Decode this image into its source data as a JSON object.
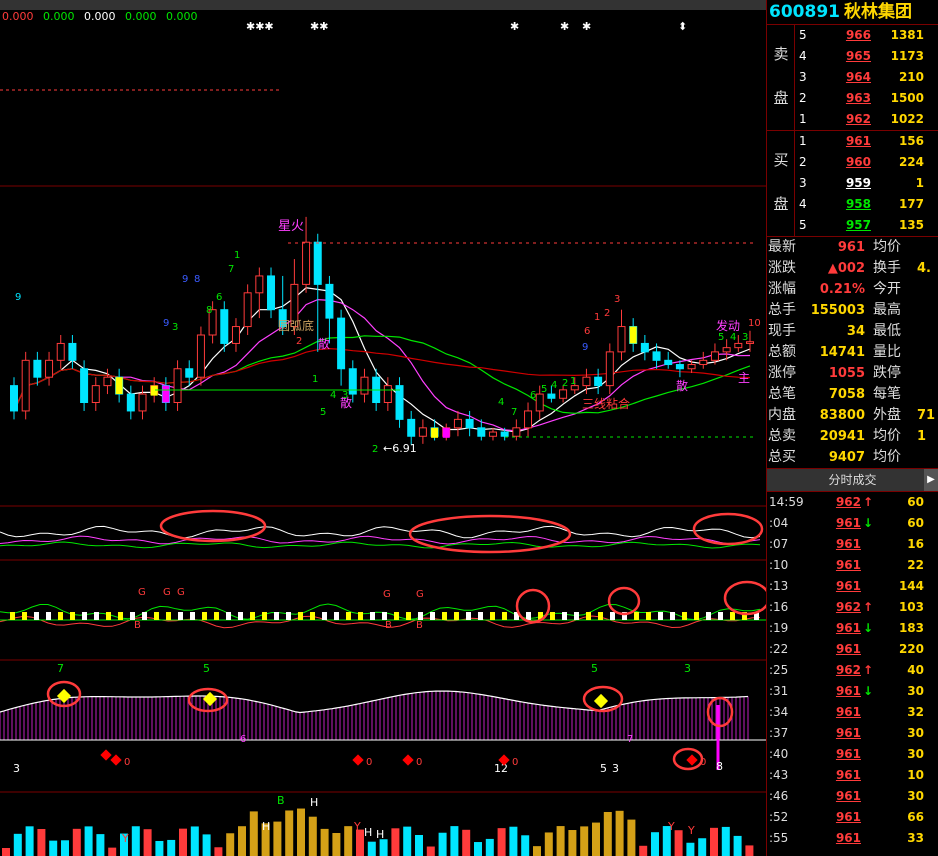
{
  "ma_values": [
    "0.000",
    "0.000",
    "0.000",
    "0.000",
    "0.000"
  ],
  "ma_colors": [
    "#ff3b3b",
    "#00e600",
    "#ffffff",
    "#00e600",
    "#00e600"
  ],
  "stock": {
    "code": "600891",
    "name": "秋林集团"
  },
  "order_book": {
    "sell_label": [
      "卖",
      "盘"
    ],
    "buy_label": [
      "买",
      "盘"
    ],
    "sell": [
      {
        "level": "5",
        "price": "966",
        "vol": "1381",
        "dir": "up"
      },
      {
        "level": "4",
        "price": "965",
        "vol": "1173",
        "dir": "up"
      },
      {
        "level": "3",
        "price": "964",
        "vol": "210",
        "dir": "up"
      },
      {
        "level": "2",
        "price": "963",
        "vol": "1500",
        "dir": "up"
      },
      {
        "level": "1",
        "price": "962",
        "vol": "1022",
        "dir": "up"
      }
    ],
    "buy": [
      {
        "level": "1",
        "price": "961",
        "vol": "156",
        "dir": "up"
      },
      {
        "level": "2",
        "price": "960",
        "vol": "224",
        "dir": "up"
      },
      {
        "level": "3",
        "price": "959",
        "vol": "1",
        "dir": "fl"
      },
      {
        "level": "4",
        "price": "958",
        "vol": "177",
        "dir": "dn"
      },
      {
        "level": "5",
        "price": "957",
        "vol": "135",
        "dir": "dn"
      }
    ]
  },
  "stats": [
    {
      "k": "最新",
      "v": "961",
      "c": "up",
      "k2": "均价",
      "v2": ""
    },
    {
      "k": "涨跌",
      "v": "▲002",
      "c": "up",
      "k2": "换手",
      "v2": "4."
    },
    {
      "k": "涨幅",
      "v": "0.21%",
      "c": "up",
      "k2": "今开",
      "v2": ""
    },
    {
      "k": "总手",
      "v": "155003",
      "c": "ye",
      "k2": "最高",
      "v2": ""
    },
    {
      "k": "现手",
      "v": "34",
      "c": "ye",
      "k2": "最低",
      "v2": ""
    },
    {
      "k": "总额",
      "v": "14741",
      "c": "ye",
      "k2": "量比",
      "v2": ""
    },
    {
      "k": "涨停",
      "v": "1055",
      "c": "up",
      "k2": "跌停",
      "v2": ""
    },
    {
      "k": "总笔",
      "v": "7058",
      "c": "ye",
      "k2": "每笔",
      "v2": ""
    },
    {
      "k": "内盘",
      "v": "83800",
      "c": "ye",
      "k2": "外盘",
      "v2": "71"
    },
    {
      "k": "总卖",
      "v": "20941",
      "c": "ye",
      "k2": "均价",
      "v2": "1"
    },
    {
      "k": "总买",
      "v": "9407",
      "c": "ye",
      "k2": "均价",
      "v2": ""
    }
  ],
  "ticks_title": "分时成交",
  "ticks": [
    {
      "t": "14:59",
      "p": "962",
      "a": "↑",
      "v": "60",
      "c": "up"
    },
    {
      "t": ":04",
      "p": "961",
      "a": "↓",
      "v": "60",
      "c": "up"
    },
    {
      "t": ":07",
      "p": "961",
      "a": "",
      "v": "16",
      "c": "up"
    },
    {
      "t": ":10",
      "p": "961",
      "a": "",
      "v": "22",
      "c": "up"
    },
    {
      "t": ":13",
      "p": "961",
      "a": "",
      "v": "144",
      "c": "up"
    },
    {
      "t": ":16",
      "p": "962",
      "a": "↑",
      "v": "103",
      "c": "up"
    },
    {
      "t": ":19",
      "p": "961",
      "a": "↓",
      "v": "183",
      "c": "up"
    },
    {
      "t": ":22",
      "p": "961",
      "a": "",
      "v": "220",
      "c": "up"
    },
    {
      "t": ":25",
      "p": "962",
      "a": "↑",
      "v": "40",
      "c": "up"
    },
    {
      "t": ":31",
      "p": "961",
      "a": "↓",
      "v": "30",
      "c": "up"
    },
    {
      "t": ":34",
      "p": "961",
      "a": "",
      "v": "32",
      "c": "up"
    },
    {
      "t": ":37",
      "p": "961",
      "a": "",
      "v": "30",
      "c": "up"
    },
    {
      "t": ":40",
      "p": "961",
      "a": "",
      "v": "30",
      "c": "up"
    },
    {
      "t": ":43",
      "p": "961",
      "a": "",
      "v": "10",
      "c": "up"
    },
    {
      "t": ":46",
      "p": "961",
      "a": "",
      "v": "30",
      "c": "up"
    },
    {
      "t": ":52",
      "p": "961",
      "a": "",
      "v": "66",
      "c": "up"
    },
    {
      "t": ":55",
      "p": "961",
      "a": "",
      "v": "33",
      "c": "up"
    }
  ],
  "annotations": {
    "xinghuo": "星火",
    "yuanhudi": "圆弧底",
    "sanxian": "三线粘合",
    "san1": "散",
    "san2": "散",
    "san3": "散",
    "zhu": "主",
    "fadong": "发动",
    "low_price": "←6.91",
    "top_marks": [
      "✱✱✱",
      "✱✱",
      "✱",
      "✱",
      "✱",
      "⬍"
    ],
    "kline_nums": [
      "9",
      "9",
      "8",
      "7",
      "6",
      "3",
      "2",
      "1",
      "5",
      "4",
      "3",
      "2",
      "1",
      "9",
      "8",
      "7",
      "6",
      "5",
      "4",
      "2",
      "1",
      "4",
      "3",
      "2",
      "1",
      "6",
      "5",
      "4",
      "3",
      "9",
      "10"
    ],
    "sub3_nums": [
      "7",
      "5",
      "5",
      "3"
    ],
    "sub3_bottom": [
      "3",
      "12",
      "5",
      "3",
      "8"
    ],
    "sub3_diamonds": [
      "0",
      "0",
      "0",
      "0",
      "0"
    ],
    "sub3_stars": [
      "6",
      "7"
    ],
    "sub2_g": [
      "G",
      "G",
      "G",
      "G",
      "G"
    ],
    "sub2_b": [
      "B",
      "B",
      "B"
    ],
    "sub2_h": [
      "H",
      "H"
    ],
    "vol_marks": [
      "B",
      "H",
      "H",
      "H",
      "H",
      "Y",
      "Y",
      "Y",
      "Y"
    ]
  },
  "kline": [
    {
      "o": 7.6,
      "c": 7.3,
      "h": 7.7,
      "l": 7.2
    },
    {
      "o": 7.3,
      "c": 7.9,
      "h": 8.0,
      "l": 7.2
    },
    {
      "o": 7.9,
      "c": 7.7,
      "h": 8.0,
      "l": 7.6
    },
    {
      "o": 7.7,
      "c": 7.9,
      "h": 8.0,
      "l": 7.6
    },
    {
      "o": 7.9,
      "c": 8.1,
      "h": 8.2,
      "l": 7.8
    },
    {
      "o": 8.1,
      "c": 7.9,
      "h": 8.2,
      "l": 7.8
    },
    {
      "o": 7.8,
      "c": 7.4,
      "h": 7.9,
      "l": 7.3
    },
    {
      "o": 7.4,
      "c": 7.6,
      "h": 7.7,
      "l": 7.3
    },
    {
      "o": 7.6,
      "c": 7.7,
      "h": 7.8,
      "l": 7.5
    },
    {
      "o": 7.7,
      "c": 7.5,
      "h": 7.8,
      "l": 7.4
    },
    {
      "o": 7.5,
      "c": 7.3,
      "h": 7.6,
      "l": 7.2
    },
    {
      "o": 7.3,
      "c": 7.5,
      "h": 7.6,
      "l": 7.2
    },
    {
      "o": 7.5,
      "c": 7.6,
      "h": 7.7,
      "l": 7.4
    },
    {
      "o": 7.6,
      "c": 7.4,
      "h": 7.7,
      "l": 7.3
    },
    {
      "o": 7.4,
      "c": 7.8,
      "h": 7.9,
      "l": 7.3
    },
    {
      "o": 7.8,
      "c": 7.7,
      "h": 7.9,
      "l": 7.6
    },
    {
      "o": 7.7,
      "c": 8.2,
      "h": 8.3,
      "l": 7.6
    },
    {
      "o": 8.2,
      "c": 8.5,
      "h": 8.6,
      "l": 8.1
    },
    {
      "o": 8.5,
      "c": 8.1,
      "h": 8.6,
      "l": 8.0
    },
    {
      "o": 8.1,
      "c": 8.3,
      "h": 8.4,
      "l": 8.0
    },
    {
      "o": 8.3,
      "c": 8.7,
      "h": 8.8,
      "l": 8.2
    },
    {
      "o": 8.7,
      "c": 8.9,
      "h": 9.0,
      "l": 8.4
    },
    {
      "o": 8.9,
      "c": 8.5,
      "h": 9.0,
      "l": 8.4
    },
    {
      "o": 8.5,
      "c": 8.3,
      "h": 8.9,
      "l": 8.2
    },
    {
      "o": 8.3,
      "c": 8.8,
      "h": 9.1,
      "l": 8.2
    },
    {
      "o": 8.8,
      "c": 9.3,
      "h": 9.6,
      "l": 8.7
    },
    {
      "o": 9.3,
      "c": 8.8,
      "h": 9.4,
      "l": 8.0
    },
    {
      "o": 8.8,
      "c": 8.4,
      "h": 8.9,
      "l": 8.1
    },
    {
      "o": 8.4,
      "c": 7.8,
      "h": 8.5,
      "l": 7.6
    },
    {
      "o": 7.8,
      "c": 7.5,
      "h": 7.9,
      "l": 7.4
    },
    {
      "o": 7.5,
      "c": 7.7,
      "h": 7.8,
      "l": 7.4
    },
    {
      "o": 7.7,
      "c": 7.4,
      "h": 7.8,
      "l": 7.3
    },
    {
      "o": 7.4,
      "c": 7.6,
      "h": 7.7,
      "l": 7.3
    },
    {
      "o": 7.6,
      "c": 7.2,
      "h": 7.7,
      "l": 7.1
    },
    {
      "o": 7.2,
      "c": 7.0,
      "h": 7.3,
      "l": 6.9
    },
    {
      "o": 7.0,
      "c": 7.1,
      "h": 7.2,
      "l": 6.91
    },
    {
      "o": 7.1,
      "c": 7.0,
      "h": 7.2,
      "l": 6.95
    },
    {
      "o": 7.0,
      "c": 7.1,
      "h": 7.15,
      "l": 6.95
    },
    {
      "o": 7.1,
      "c": 7.2,
      "h": 7.3,
      "l": 7.0
    },
    {
      "o": 7.2,
      "c": 7.1,
      "h": 7.3,
      "l": 7.0
    },
    {
      "o": 7.1,
      "c": 7.0,
      "h": 7.2,
      "l": 6.95
    },
    {
      "o": 7.0,
      "c": 7.05,
      "h": 7.1,
      "l": 6.95
    },
    {
      "o": 7.05,
      "c": 7.0,
      "h": 7.1,
      "l": 6.95
    },
    {
      "o": 7.0,
      "c": 7.1,
      "h": 7.2,
      "l": 6.95
    },
    {
      "o": 7.1,
      "c": 7.3,
      "h": 7.4,
      "l": 7.0
    },
    {
      "o": 7.3,
      "c": 7.5,
      "h": 7.6,
      "l": 7.2
    },
    {
      "o": 7.5,
      "c": 7.45,
      "h": 7.6,
      "l": 7.4
    },
    {
      "o": 7.45,
      "c": 7.55,
      "h": 7.6,
      "l": 7.4
    },
    {
      "o": 7.55,
      "c": 7.6,
      "h": 7.7,
      "l": 7.5
    },
    {
      "o": 7.6,
      "c": 7.7,
      "h": 7.8,
      "l": 7.5
    },
    {
      "o": 7.7,
      "c": 7.6,
      "h": 7.8,
      "l": 7.5
    },
    {
      "o": 7.6,
      "c": 8.0,
      "h": 8.1,
      "l": 7.5
    },
    {
      "o": 8.0,
      "c": 8.3,
      "h": 8.5,
      "l": 7.9
    },
    {
      "o": 8.3,
      "c": 8.1,
      "h": 8.4,
      "l": 8.0
    },
    {
      "o": 8.1,
      "c": 8.0,
      "h": 8.2,
      "l": 7.9
    },
    {
      "o": 8.0,
      "c": 7.9,
      "h": 8.1,
      "l": 7.8
    },
    {
      "o": 7.9,
      "c": 7.85,
      "h": 8.0,
      "l": 7.8
    },
    {
      "o": 7.85,
      "c": 7.8,
      "h": 7.9,
      "l": 7.7
    },
    {
      "o": 7.8,
      "c": 7.85,
      "h": 7.9,
      "l": 7.75
    },
    {
      "o": 7.85,
      "c": 7.9,
      "h": 8.0,
      "l": 7.8
    },
    {
      "o": 7.9,
      "c": 8.0,
      "h": 8.1,
      "l": 7.85
    },
    {
      "o": 8.0,
      "c": 8.05,
      "h": 8.15,
      "l": 7.9
    },
    {
      "o": 8.05,
      "c": 8.1,
      "h": 8.2,
      "l": 8.0
    },
    {
      "o": 8.1,
      "c": 8.12,
      "h": 8.25,
      "l": 8.0
    }
  ]
}
